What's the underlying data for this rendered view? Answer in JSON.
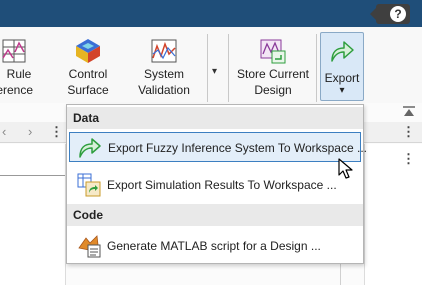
{
  "toolstrip": {
    "buttons": [
      {
        "line1": "Rule",
        "line2": "ference"
      },
      {
        "line1": "Control",
        "line2": "Surface"
      },
      {
        "line1": "System",
        "line2": "Validation"
      },
      {
        "line1": "Store Current",
        "line2": "Design"
      },
      {
        "line1": "Export",
        "line2": ""
      }
    ],
    "export_arrow": "▾",
    "gallery_arrow": "▾"
  },
  "help": {
    "label": "?"
  },
  "export_menu": {
    "sections": [
      {
        "title": "Data",
        "items": [
          {
            "label": "Export Fuzzy Inference System To Workspace ...",
            "icon": "export-arrow-icon",
            "highlighted": true
          },
          {
            "label": "Export Simulation Results To Workspace ...",
            "icon": "export-results-icon",
            "highlighted": false
          }
        ]
      },
      {
        "title": "Code",
        "items": [
          {
            "label": "Generate MATLAB script for a Design ...",
            "icon": "matlab-script-icon",
            "highlighted": false
          }
        ]
      }
    ]
  },
  "colors": {
    "title_bar": "#1f4e79",
    "highlight_border": "#3c7fc1",
    "highlight_bg": "#e3eef9",
    "export_green": "#2e9e3e"
  }
}
